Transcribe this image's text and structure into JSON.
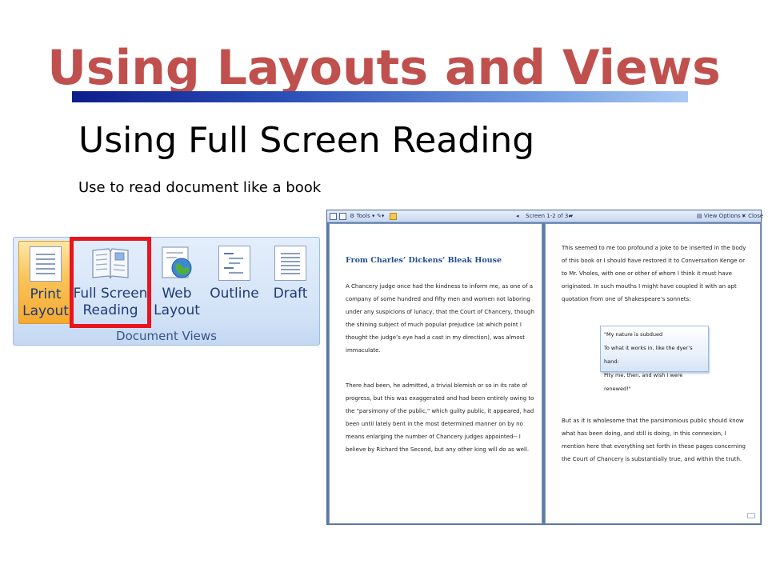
{
  "slide": {
    "title": "Using Layouts and Views",
    "heading": "Using Full Screen Reading",
    "subtext": "Use to read document like a book"
  },
  "ribbon": {
    "buttons": [
      {
        "line1": "Print",
        "line2": "Layout",
        "active": true
      },
      {
        "line1": "Full Screen",
        "line2": "Reading",
        "active": false
      },
      {
        "line1": "Web",
        "line2": "Layout",
        "active": false
      },
      {
        "line1": "Outline",
        "line2": "",
        "active": false
      },
      {
        "line1": "Draft",
        "line2": "",
        "active": false
      }
    ],
    "group_label": "Document Views",
    "colors": {
      "highlight": "#e8141e",
      "active": "#f9c45a"
    }
  },
  "reader": {
    "toolbar": {
      "tools": "Tools",
      "screen": "Screen 1-2 of 3",
      "view_options": "View Options",
      "close": "Close"
    },
    "left_page": {
      "title": "From Charles’ Dickens’ Bleak House",
      "para1": "A Chancery judge once had the kindness to inform me, as one of a company of some hundred and fifty men and women not laboring under any suspicions of lunacy, that the Court of Chancery, though the shining subject of much popular prejudice (at which point I thought the judge’s eye had a cast in my direction), was almost immaculate.",
      "para2": "There had been, he admitted, a trivial blemish or so in its rate of progress, but this was exaggerated and had been entirely owing to the \"parsimony of the public,\" which guilty public, it appeared, had been until lately bent in the most determined manner on by no means enlarging the number of Chancery judges appointed-- I believe by Richard the Second, but any other king will do as well."
    },
    "right_page": {
      "para1": "This seemed to me too profound a joke to be inserted in the body of this book or I should have restored it to Conversation Kenge or to Mr. Vholes, with one or other of whom I think it must have originated. In such mouths I might have coupled it with an apt quotation from one of Shakespeare’s sonnets:",
      "quote": [
        "\"My nature is subdued",
        "To what it works in, like the dyer’s hand:",
        "Pity me, then, and wish I were renewed!\""
      ],
      "para2": "But as it is wholesome that the parsimonious public should know what has been doing, and still is doing, in this connexion, I mention here that everything set forth in these pages concerning the Court of Chancery is substantially true, and within the truth."
    }
  }
}
